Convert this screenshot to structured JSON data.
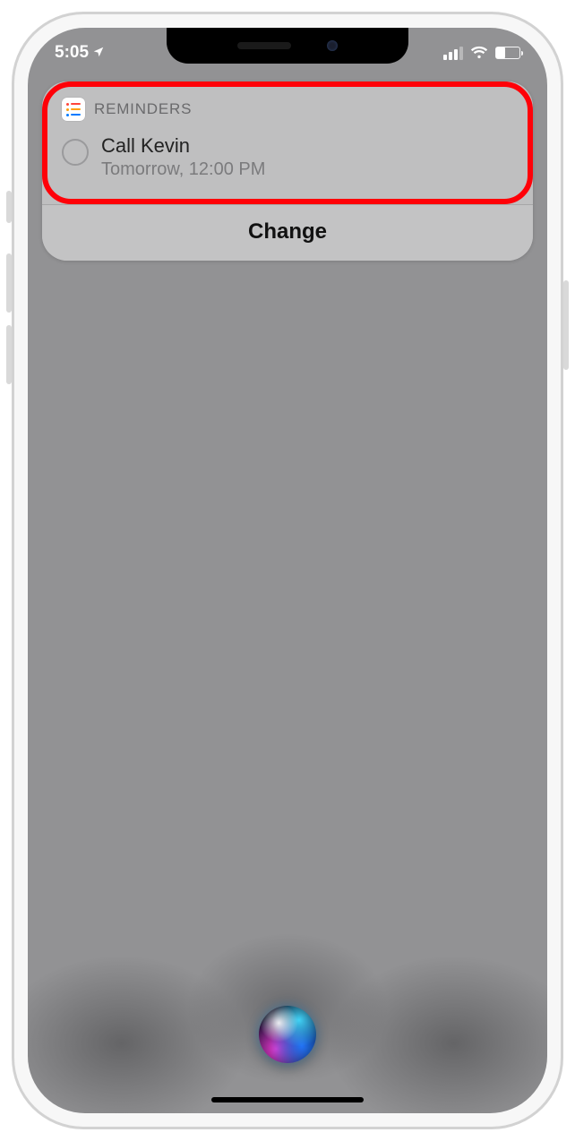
{
  "status": {
    "time": "5:05",
    "location_icon": "location-arrow"
  },
  "card": {
    "app_name": "REMINDERS",
    "reminder_title": "Call Kevin",
    "reminder_subtitle": "Tomorrow, 12:00 PM",
    "change_label": "Change"
  }
}
